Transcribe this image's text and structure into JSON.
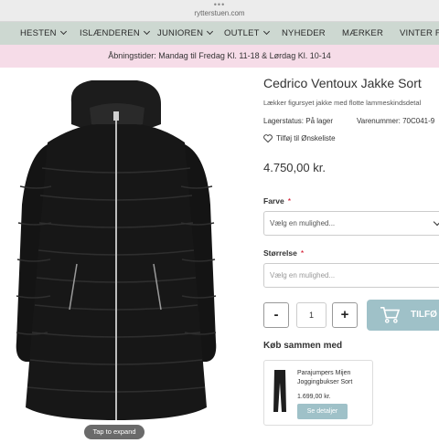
{
  "browser": {
    "dots": "•••",
    "url": "rytterstuen.com"
  },
  "nav": {
    "items": [
      {
        "label": "HESTEN",
        "dropdown": true
      },
      {
        "label": "ISLÆNDEREN",
        "dropdown": true
      },
      {
        "label": "JUNIOREN",
        "dropdown": true
      },
      {
        "label": "OUTLET",
        "dropdown": true
      },
      {
        "label": "NYHEDER",
        "dropdown": false
      },
      {
        "label": "MÆRKER",
        "dropdown": false
      },
      {
        "label": "VINTER FAV",
        "dropdown": false
      }
    ]
  },
  "banner": {
    "text": "Åbningstider: Mandag til Fredag Kl. 11-18 & Lørdag Kl. 10-14"
  },
  "image": {
    "tap_label": "Tap to expand",
    "icon": "jacket-image"
  },
  "product": {
    "title": "Cedrico Ventoux Jakke Sort",
    "description": "Lækker figursyet jakke med flotte lammeskindsdetal",
    "stock": "Lagerstatus:  På lager",
    "sku": "Varenummer:  70C041-9",
    "wishlist": "Tilføj til Ønskeliste",
    "price": "4.750,00 kr."
  },
  "options": {
    "color_label": "Farve",
    "color_required": "*",
    "color_value": "Vælg en mulighed...",
    "size_label": "Størrelse",
    "size_required": "*",
    "size_placeholder": "Vælg en mulighed..."
  },
  "cart": {
    "minus": "-",
    "quantity": "1",
    "plus": "+",
    "add_label": "TILFØ",
    "icon": "cart-icon"
  },
  "bundle": {
    "heading": "Køb sammen med",
    "item_name": "Parajumpers Mijen Joggingbukser Sort",
    "item_price": "1.699,00 kr.",
    "item_button": "Se detaljer"
  },
  "colors": {
    "nav_bg": "#cdd8d1",
    "banner_bg": "#f6dce8",
    "accent": "#9fc1c8",
    "required": "#d0021b"
  }
}
